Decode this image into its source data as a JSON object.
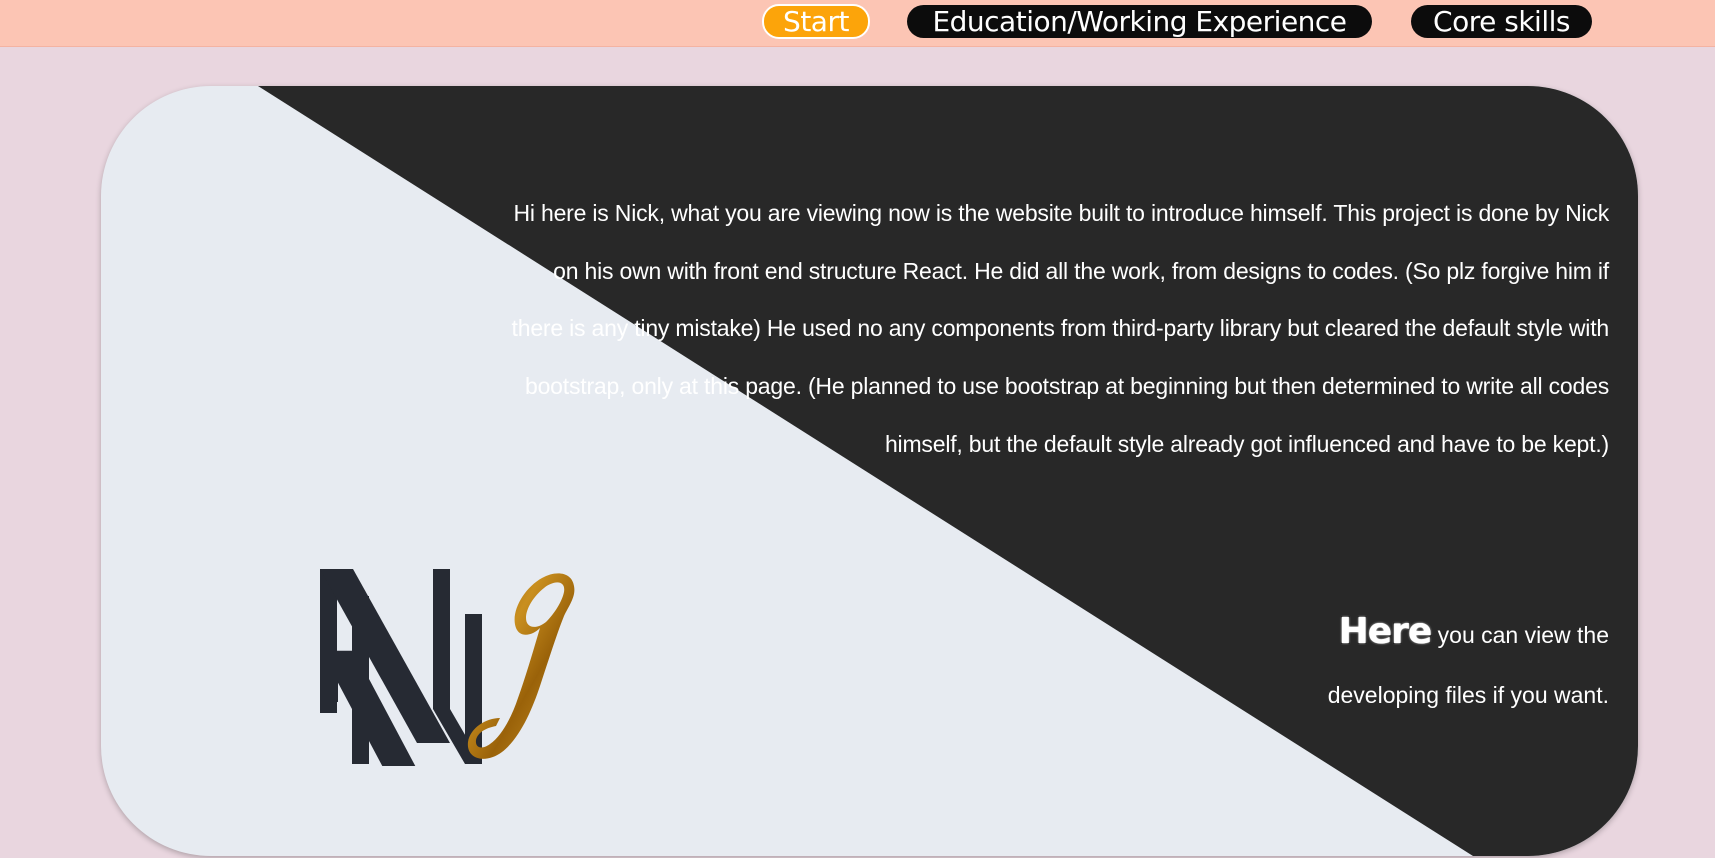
{
  "nav": {
    "start": "Start",
    "education": "Education/Working Experience",
    "core_skills": "Core skills"
  },
  "intro": {
    "paragraph": "Hi here is Nick, what you are viewing now is the website built to introduce himself. This project is done by Nick on his own with front end structure React. He did all the work, from designs to codes. (So plz forgive him if there is any tiny mistake) He used no any components from third-party library but cleared the default style with bootstrap, only at this page. (He planned to use bootstrap at beginning but then determined to write all codes himself, but the default style already got influenced and have to be kept.)",
    "link_text": "Here",
    "link_suffix": " you can view the",
    "link_line2": "developing files if you want."
  },
  "logo": {
    "letter_n": "N",
    "letter_j": "J",
    "n_color": "#262a33",
    "j_color": "#b8780f"
  },
  "colors": {
    "navbar_bg": "#fcc5b4",
    "page_bg": "#e9d6df",
    "start_bg": "#fca40a",
    "nav_dark": "#0c0c0c",
    "card_dark": "#282828",
    "card_light": "#e7ebf1"
  }
}
